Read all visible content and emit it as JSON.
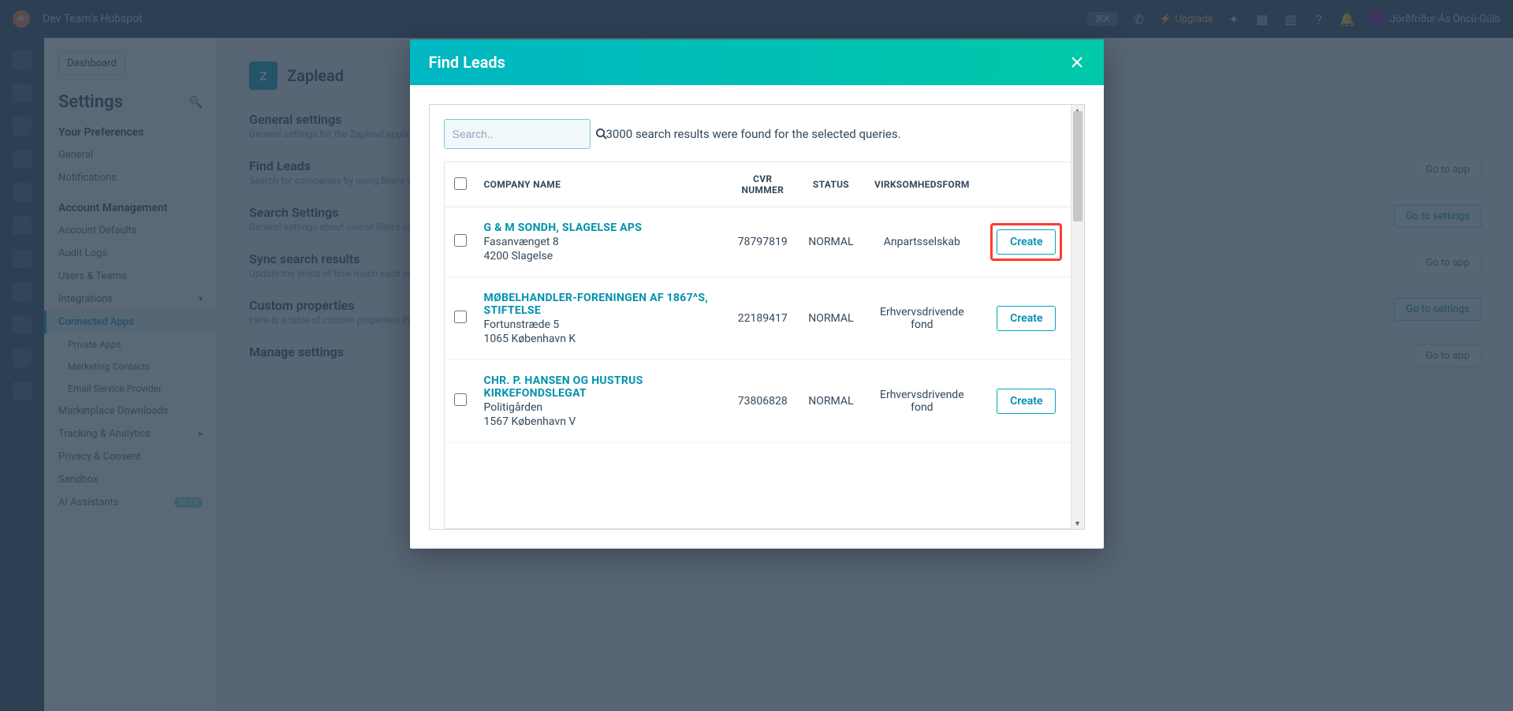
{
  "topbar": {
    "account": "Dev Team's Hubspot",
    "upgrade": "Upgrade",
    "user": "Jörðfríður-Ás Öncü-Gülb"
  },
  "sidebar": {
    "back": "Dashboard",
    "title": "Settings",
    "pref_head": "Your Preferences",
    "pref": [
      "General",
      "Notifications"
    ],
    "acct_head": "Account Management",
    "acct_items": [
      "Account Defaults",
      "Audit Logs",
      "Users & Teams",
      "Integrations"
    ],
    "connected": "Connected Apps",
    "connected_children": [
      "Private Apps",
      "Marketing Contacts",
      "Email Service Provider"
    ],
    "more": [
      "Marketplace Downloads",
      "Tracking & Analytics",
      "Privacy & Consent",
      "Sandbox",
      "AI Assistants"
    ],
    "beta": "BETA"
  },
  "main": {
    "app_initial": "Z",
    "app_title": "Zaplead",
    "sections": [
      {
        "title": "General settings",
        "sub": "General settings for the Zaplead application",
        "btn": ""
      },
      {
        "title": "Find Leads",
        "sub": "Search for companies by using filters and add them to your HubSpot",
        "btn": "Go to app"
      },
      {
        "title": "Search Settings",
        "sub": "General settings about overall filters users can select from when searching for new leads",
        "btn": "Go to settings"
      },
      {
        "title": "Sync search results",
        "sub": "Update the limits of how much each user can sync company data",
        "btn": "Go to app"
      },
      {
        "title": "Custom properties",
        "sub": "Here is a table of custom properties that Zaplead creates when you install the app",
        "btn": "Go to settings"
      },
      {
        "title": "Manage settings",
        "sub": "",
        "btn": "Go to app"
      }
    ]
  },
  "modal": {
    "title": "Find Leads",
    "search_placeholder": "Search..",
    "results_text": "3000 search results were found for the selected queries.",
    "columns": {
      "company": "COMPANY NAME",
      "cvr": "CVR NUMMER",
      "status": "STATUS",
      "form": "VIRKSOMHEDSFORM"
    },
    "create_label": "Create",
    "rows": [
      {
        "name": "G & M SONDH, SLAGELSE ApS",
        "addr1": "Fasanvænget 8",
        "addr2": "4200 Slagelse",
        "cvr": "78797819",
        "status": "NORMAL",
        "form": "Anpartsselskab",
        "highlight": true
      },
      {
        "name": "MØBELHANDLER-FORENINGEN AF 1867^S, STIFTELSE",
        "addr1": "Fortunstræde 5",
        "addr2": "1065 København K",
        "cvr": "22189417",
        "status": "NORMAL",
        "form": "Erhvervsdrivende fond",
        "highlight": false
      },
      {
        "name": "CHR. P. HANSEN OG HUSTRUS KIRKEFONDSLEGAT",
        "addr1": "Politigården",
        "addr2": "1567 København V",
        "cvr": "73806828",
        "status": "NORMAL",
        "form": "Erhvervsdrivende fond",
        "highlight": false
      }
    ]
  }
}
